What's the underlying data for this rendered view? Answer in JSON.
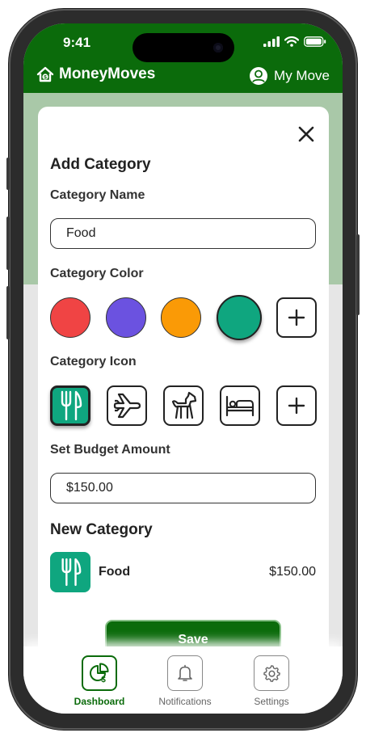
{
  "status_bar": {
    "time": "9:41"
  },
  "header": {
    "app_title": "MoneyMoves",
    "profile_label": "My Move"
  },
  "modal": {
    "title": "Add Category",
    "name_label": "Category Name",
    "name_value": "Food",
    "color_label": "Category Color",
    "colors": [
      "#f04444",
      "#6b52e0",
      "#fa9a06",
      "#0fa67f"
    ],
    "selected_color": "#0fa67f",
    "icon_label": "Category Icon",
    "icons": [
      "fork-knife-icon",
      "airplane-icon",
      "dog-icon",
      "bed-icon"
    ],
    "budget_label": "Set Budget Amount",
    "budget_value": "$150.00",
    "preview_title": "New Category",
    "preview_name": "Food",
    "preview_amount": "$150.00",
    "save_label": "Save"
  },
  "nav": {
    "items": [
      {
        "label": "Dashboard",
        "icon": "pie-dollar-icon",
        "active": true
      },
      {
        "label": "Notifications",
        "icon": "bell-icon",
        "active": false
      },
      {
        "label": "Settings",
        "icon": "gear-icon",
        "active": false
      }
    ]
  },
  "colors": {
    "brand": "#0b6b0b",
    "accent": "#0fa67f"
  }
}
